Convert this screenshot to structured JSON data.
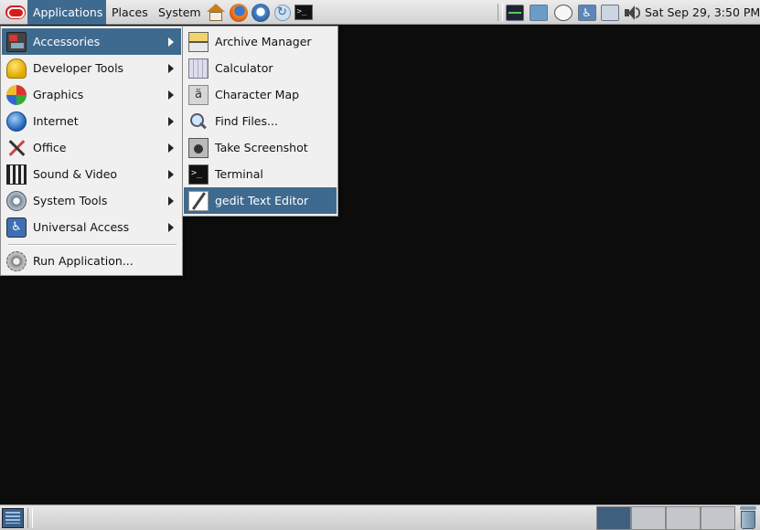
{
  "top_panel": {
    "applications_label": "Applications",
    "places_label": "Places",
    "system_label": "System",
    "launchers": [
      "home-icon",
      "firefox-icon",
      "thunderbird-icon",
      "refresh-icon",
      "terminal-icon"
    ],
    "tray": [
      "system-monitor-icon",
      "network-icon",
      "clock-applet-icon",
      "accessibility-icon",
      "network-status-icon",
      "volume-icon"
    ],
    "clock": "Sat Sep 29,  3:50 PM"
  },
  "applications_menu": {
    "items": [
      {
        "label": "Accessories",
        "icon": "accessories-icon",
        "submenu": true,
        "active": true
      },
      {
        "label": "Developer Tools",
        "icon": "developer-tools-icon",
        "submenu": true
      },
      {
        "label": "Graphics",
        "icon": "graphics-icon",
        "submenu": true
      },
      {
        "label": "Internet",
        "icon": "internet-icon",
        "submenu": true
      },
      {
        "label": "Office",
        "icon": "office-icon",
        "submenu": true
      },
      {
        "label": "Sound & Video",
        "icon": "sound-video-icon",
        "submenu": true
      },
      {
        "label": "System Tools",
        "icon": "system-tools-icon",
        "submenu": true
      },
      {
        "label": "Universal Access",
        "icon": "universal-access-icon",
        "submenu": true
      }
    ],
    "run_application": "Run Application..."
  },
  "accessories_menu": {
    "items": [
      {
        "label": "Archive Manager",
        "icon": "archive-manager-icon"
      },
      {
        "label": "Calculator",
        "icon": "calculator-icon"
      },
      {
        "label": "Character Map",
        "icon": "character-map-icon"
      },
      {
        "label": "Find Files...",
        "icon": "find-files-icon"
      },
      {
        "label": "Take Screenshot",
        "icon": "screenshot-icon"
      },
      {
        "label": "Terminal",
        "icon": "terminal-icon"
      },
      {
        "label": "gedit Text Editor",
        "icon": "gedit-icon",
        "active": true
      }
    ]
  },
  "bottom_panel": {
    "workspaces": [
      {
        "active": true
      },
      {
        "active": false
      },
      {
        "active": false
      },
      {
        "active": false
      }
    ],
    "trash_icon": "trash-icon"
  },
  "colors": {
    "menu_highlight": "#3f6a8f",
    "desktop": "#0c0c0c",
    "panel": "#dcdcdc"
  }
}
